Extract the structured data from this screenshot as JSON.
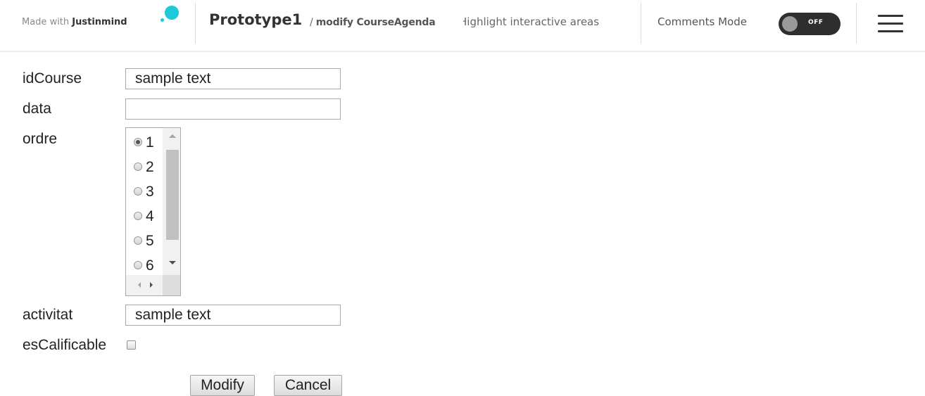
{
  "topbar": {
    "made_with_prefix": "Made with ",
    "made_with_brand": "Justinmind",
    "project_title": "Prototype1",
    "breadcrumb_separator": "/",
    "page_name": "modify CourseAgenda",
    "highlight_hint": "Highlight interactive areas",
    "comments_mode_label": "Comments Mode",
    "comments_toggle_state": "OFF",
    "brand_color": "#1ccad8"
  },
  "form": {
    "idcourse": {
      "label": "idCourse",
      "value": "sample text"
    },
    "data": {
      "label": "data",
      "value": ""
    },
    "ordre": {
      "label": "ordre",
      "selected": "1",
      "options": [
        "1",
        "2",
        "3",
        "4",
        "5",
        "6"
      ]
    },
    "activitat": {
      "label": "activitat",
      "value": "sample text"
    },
    "escalificable": {
      "label": "esCalificable",
      "checked": false
    }
  },
  "buttons": {
    "modify": "Modify",
    "cancel": "Cancel"
  }
}
